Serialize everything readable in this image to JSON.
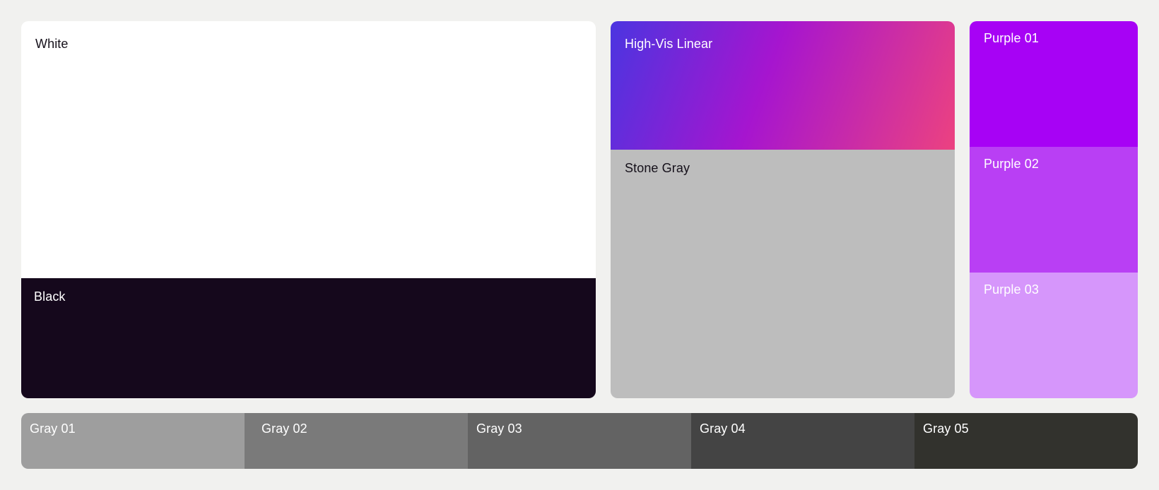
{
  "palette": {
    "white": {
      "label": "White",
      "color": "#ffffff",
      "text_color": "#15101a"
    },
    "black": {
      "label": "Black",
      "color": "#15081c",
      "text_color": "#ffffff"
    },
    "high_vis": {
      "label": "High-Vis Linear",
      "gradient_colors": [
        "#4b35e0",
        "#a615cf",
        "#ec4280"
      ],
      "text_color": "#ffffff"
    },
    "stone_gray": {
      "label": "Stone Gray",
      "color": "#bdbdbd",
      "text_color": "#15101a"
    },
    "purples": [
      {
        "label": "Purple 01",
        "color": "#a702f5",
        "text_color": "#ffffff"
      },
      {
        "label": "Purple 02",
        "color": "#b93ff4",
        "text_color": "#ffffff"
      },
      {
        "label": "Purple 03",
        "color": "#d696fb",
        "text_color": "#ffffff"
      }
    ],
    "grays": [
      {
        "label": "Gray 01",
        "color": "#9e9e9e",
        "text_color": "#ffffff"
      },
      {
        "label": "Gray 02",
        "color": "#7a7a7a",
        "text_color": "#ffffff"
      },
      {
        "label": "Gray 03",
        "color": "#636363",
        "text_color": "#ffffff"
      },
      {
        "label": "Gray 04",
        "color": "#444444",
        "text_color": "#ffffff"
      },
      {
        "label": "Gray 05",
        "color": "#32322d",
        "text_color": "#ffffff"
      }
    ]
  }
}
